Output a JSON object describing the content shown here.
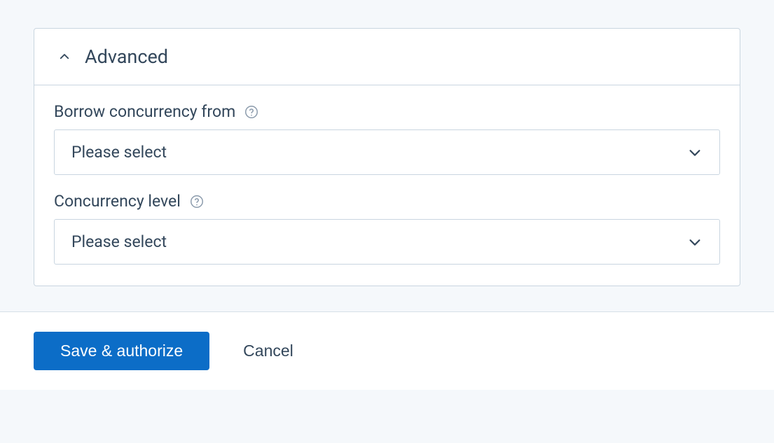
{
  "panel": {
    "title": "Advanced",
    "expanded": true
  },
  "fields": {
    "borrow_concurrency": {
      "label": "Borrow concurrency from",
      "value": "Please select"
    },
    "concurrency_level": {
      "label": "Concurrency level",
      "value": "Please select"
    }
  },
  "footer": {
    "primary_label": "Save & authorize",
    "secondary_label": "Cancel"
  }
}
